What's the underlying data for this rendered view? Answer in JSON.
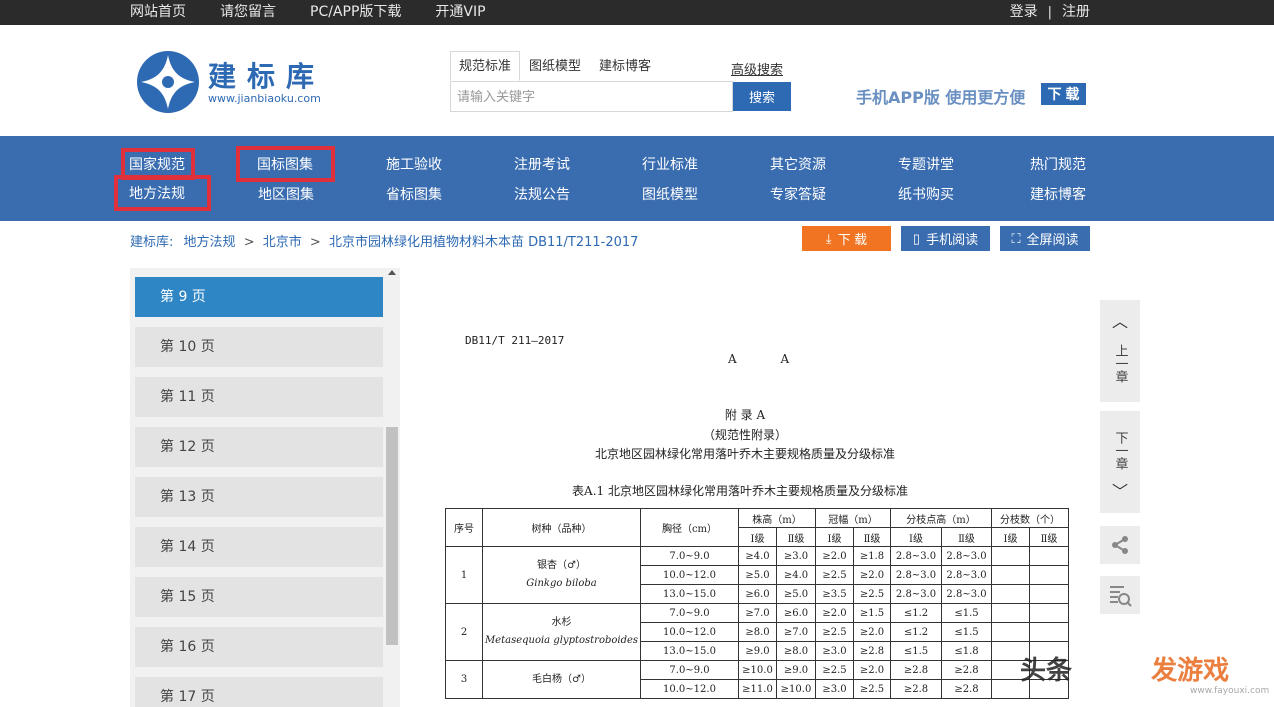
{
  "topbar": {
    "links": [
      "网站首页",
      "请您留言",
      "PC/APP版下载",
      "开通VIP"
    ],
    "login": "登录",
    "separator": "|",
    "register": "注册"
  },
  "header": {
    "logo_title": "建标库",
    "logo_url": "www.jianbiaoku.com",
    "search_tabs": [
      "规范标准",
      "图纸模型",
      "建标博客"
    ],
    "advanced_search": "高级搜索",
    "search_placeholder": "请输入关键字",
    "search_button": "搜索",
    "app_promo": "手机APP版 使用更方便",
    "app_download": "下 载"
  },
  "nav": {
    "row1": [
      "国家规范",
      "国标图集",
      "施工验收",
      "注册考试",
      "行业标准",
      "其它资源",
      "专题讲堂",
      "热门规范"
    ],
    "row2": [
      "地方法规",
      "地区图集",
      "省标图集",
      "法规公告",
      "图纸模型",
      "专家答疑",
      "纸书购买",
      "建标博客"
    ]
  },
  "breadcrumb": {
    "items": [
      "建标库:",
      "地方法规",
      "北京市",
      "北京市园林绿化用植物材料木本苗 DB11/T211-2017"
    ],
    "sep": ">"
  },
  "actions": {
    "download": "下 载",
    "mobile_read": "手机阅读",
    "fullscreen_read": "全屏阅读"
  },
  "sidebar": {
    "pages": [
      "第 9 页",
      "第 10 页",
      "第 11 页",
      "第 12 页",
      "第 13 页",
      "第 14 页",
      "第 15 页",
      "第 16 页",
      "第 17 页"
    ],
    "active_index": 0
  },
  "document": {
    "code": "DB11/T 211—2017",
    "aa": "A A",
    "appendix": "附  录  A",
    "appendix_type": "（规范性附录）",
    "appendix_title": "北京地区园林绿化常用落叶乔木主要规格质量及分级标准",
    "table_caption": "表A.1   北京地区园林绿化常用落叶乔木主要规格质量及分级标准",
    "table": {
      "headers": {
        "no": "序号",
        "species": "树种（品种）",
        "dbh": "胸径（cm）",
        "height": "株高（m）",
        "crown": "冠幅（m）",
        "branch_height": "分枝点高（m）",
        "branch_count": "分枝数（个）",
        "grade1": "Ⅰ级",
        "grade2": "Ⅱ级"
      },
      "groups": [
        {
          "no": "1",
          "name_cn": "银杏（♂）",
          "name_latin": "Ginkgo biloba",
          "rows": [
            [
              "7.0~9.0",
              "≥4.0",
              "≥3.0",
              "≥2.0",
              "≥1.8",
              "2.8~3.0",
              "2.8~3.0",
              "",
              ""
            ],
            [
              "10.0~12.0",
              "≥5.0",
              "≥4.0",
              "≥2.5",
              "≥2.0",
              "2.8~3.0",
              "2.8~3.0",
              "",
              ""
            ],
            [
              "13.0~15.0",
              "≥6.0",
              "≥5.0",
              "≥3.5",
              "≥2.5",
              "2.8~3.0",
              "2.8~3.0",
              "",
              ""
            ]
          ]
        },
        {
          "no": "2",
          "name_cn": "水杉",
          "name_latin": "Metasequoia glyptostroboides",
          "rows": [
            [
              "7.0~9.0",
              "≥7.0",
              "≥6.0",
              "≥2.0",
              "≥1.5",
              "≤1.2",
              "≤1.5",
              "",
              ""
            ],
            [
              "10.0~12.0",
              "≥8.0",
              "≥7.0",
              "≥2.5",
              "≥2.0",
              "≤1.2",
              "≤1.5",
              "",
              ""
            ],
            [
              "13.0~15.0",
              "≥9.0",
              "≥8.0",
              "≥3.0",
              "≥2.8",
              "≤1.5",
              "≤1.8",
              "",
              ""
            ]
          ]
        },
        {
          "no": "3",
          "name_cn": "毛白杨（♂）",
          "name_latin": "",
          "rows": [
            [
              "7.0~9.0",
              "≥10.0",
              "≥9.0",
              "≥2.5",
              "≥2.0",
              "≥2.8",
              "≥2.8",
              "",
              ""
            ],
            [
              "10.0~12.0",
              "≥11.0",
              "≥10.0",
              "≥3.0",
              "≥2.5",
              "≥2.8",
              "≥2.8",
              "",
              ""
            ]
          ]
        }
      ]
    }
  },
  "right_tools": {
    "prev": "上一章",
    "next": "下一章"
  },
  "watermark": {
    "text": "头条",
    "brand": "发游戏",
    "site": "www.fayouxi.com"
  }
}
